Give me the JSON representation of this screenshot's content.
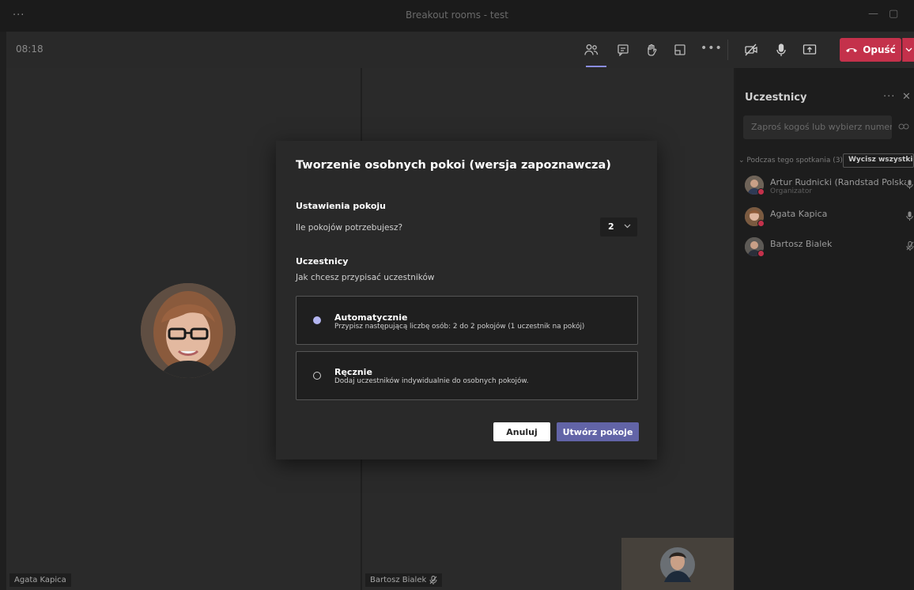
{
  "window": {
    "menu_dots": "···",
    "title": "Breakout rooms - test",
    "minimize": "—",
    "maximize": "▢"
  },
  "callbar": {
    "timer": "08:18",
    "more_dots": "•••",
    "leave_label": "Opuść"
  },
  "tiles": {
    "left_name": "Agata Kapica",
    "mid_name": "Bartosz Bialek"
  },
  "panel": {
    "title": "Uczestnicy",
    "more": "···",
    "close": "✕",
    "invite_placeholder": "Zaproś kogoś lub wybierz numer",
    "section_label": "⌄ Podczas tego spotkania (3)",
    "mute_all": "Wycisz wszystkich",
    "participants": [
      {
        "name": "Artur Rudnicki (Randstad Polska ...",
        "role": "Organizator"
      },
      {
        "name": "Agata Kapica",
        "role": ""
      },
      {
        "name": "Bartosz Bialek",
        "role": ""
      }
    ]
  },
  "dialog": {
    "title": "Tworzenie osobnych pokoi (wersja zapoznawcza)",
    "room_settings_heading": "Ustawienia pokoju",
    "rooms_question": "Ile pokojów potrzebujesz?",
    "rooms_count": "2",
    "participants_heading": "Uczestnicy",
    "assign_question": "Jak chcesz przypisać uczestników",
    "option_auto": {
      "title": "Automatycznie",
      "desc": "Przypisz następującą liczbę osób: 2 do 2 pokojów (1 uczestnik na pokój)"
    },
    "option_manual": {
      "title": "Ręcznie",
      "desc": "Dodaj uczestników indywidualnie do osobnych pokojów."
    },
    "cancel_label": "Anuluj",
    "create_label": "Utwórz pokoje"
  },
  "colors": {
    "accent": "#6264a7",
    "leave": "#c4314b",
    "radio_selected": "#b3b5f0"
  }
}
